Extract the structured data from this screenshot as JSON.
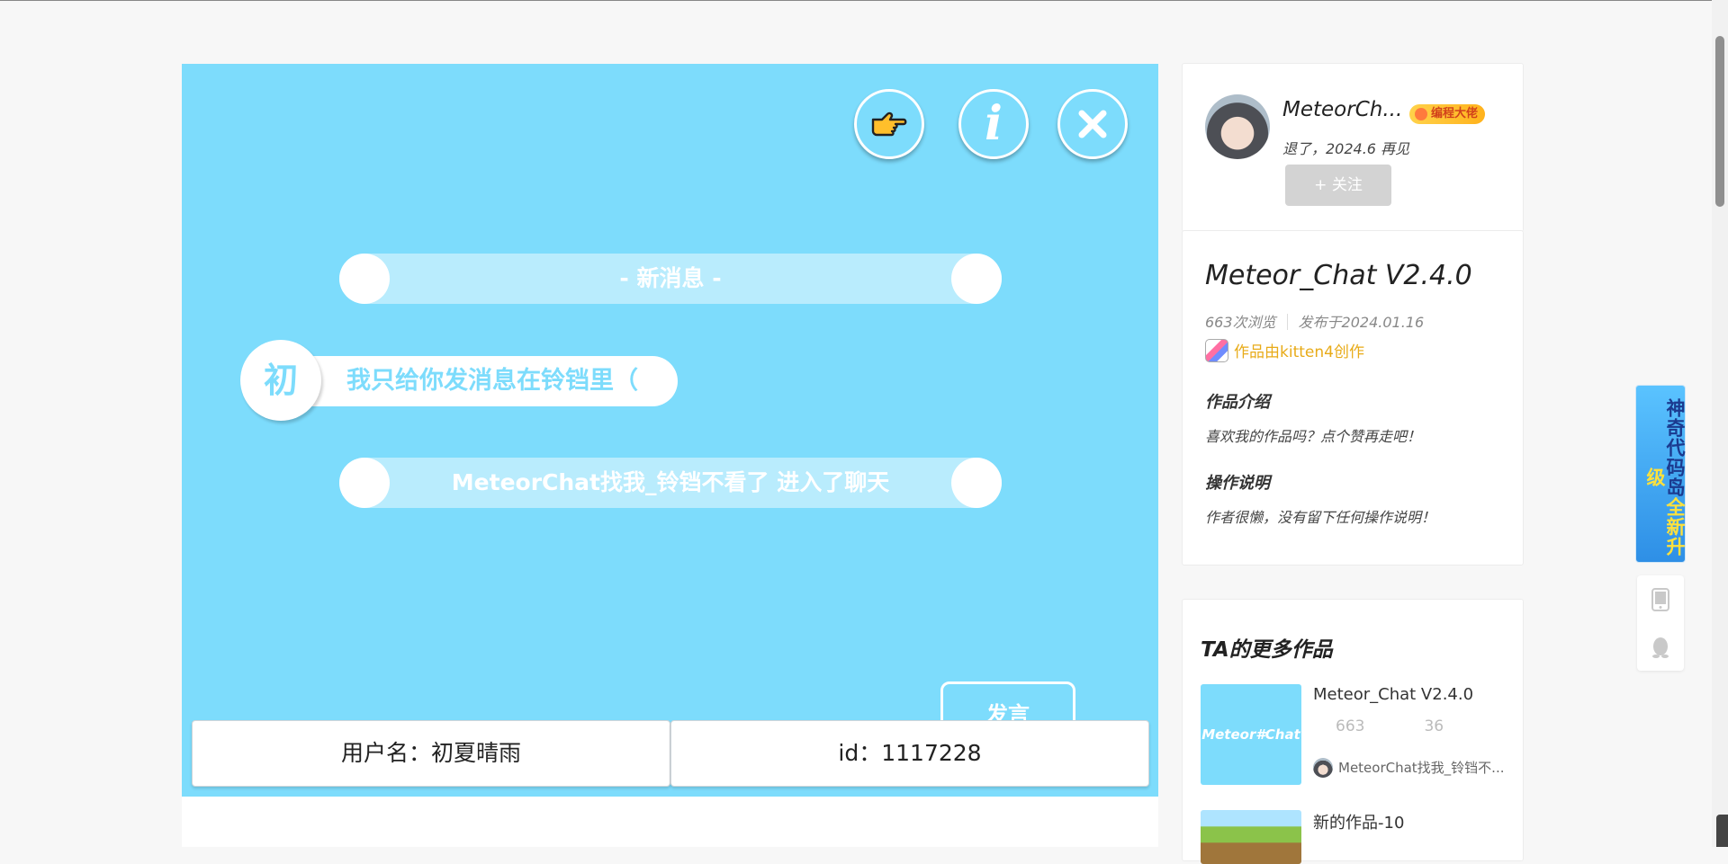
{
  "stage": {
    "buttons": {
      "pointer": "hand-pointer-icon",
      "info": "info-icon",
      "close": "close-icon"
    },
    "new_message_pill": "- 新消息 -",
    "chat_avatar_char": "初",
    "chat_message": "我只给你发消息在铃铛里（",
    "system_pill": "MeteorChat找我_铃铛不看了 进入了聊天",
    "send_button": "发言",
    "username_field": "用户名：初夏晴雨",
    "id_field": "id：1117228",
    "colors": {
      "background": "#7ddcfc",
      "pill": "#b9ecfd",
      "text": "#ffffff"
    }
  },
  "author": {
    "name": "MeteorCh...",
    "badge": "编程大佬",
    "signature": "退了，2024.6 再见",
    "follow_label": "+ 关注"
  },
  "work": {
    "title": "Meteor_Chat V2.4.0",
    "views": "663次浏览",
    "published": "发布于2024.01.16",
    "creator": "作品由kitten4创作",
    "intro_heading": "作品介绍",
    "intro_text": "喜欢我的作品吗？点个赞再走吧！",
    "ops_heading": "操作说明",
    "ops_text": "作者很懒，没有留下任何操作说明！"
  },
  "more": {
    "heading": "TA的更多作品",
    "items": [
      {
        "thumb_text": "Meteor#Chat",
        "title": "Meteor_Chat V2.4.0",
        "views": "663",
        "likes": "36",
        "author": "MeteorChat找我_铃铛不..."
      },
      {
        "title": "新的作品-10"
      }
    ]
  },
  "side": {
    "promo_a": "神奇代码岛",
    "promo_b": "全新升级",
    "tools": [
      "tablet-icon",
      "qq-penguin-icon"
    ]
  }
}
